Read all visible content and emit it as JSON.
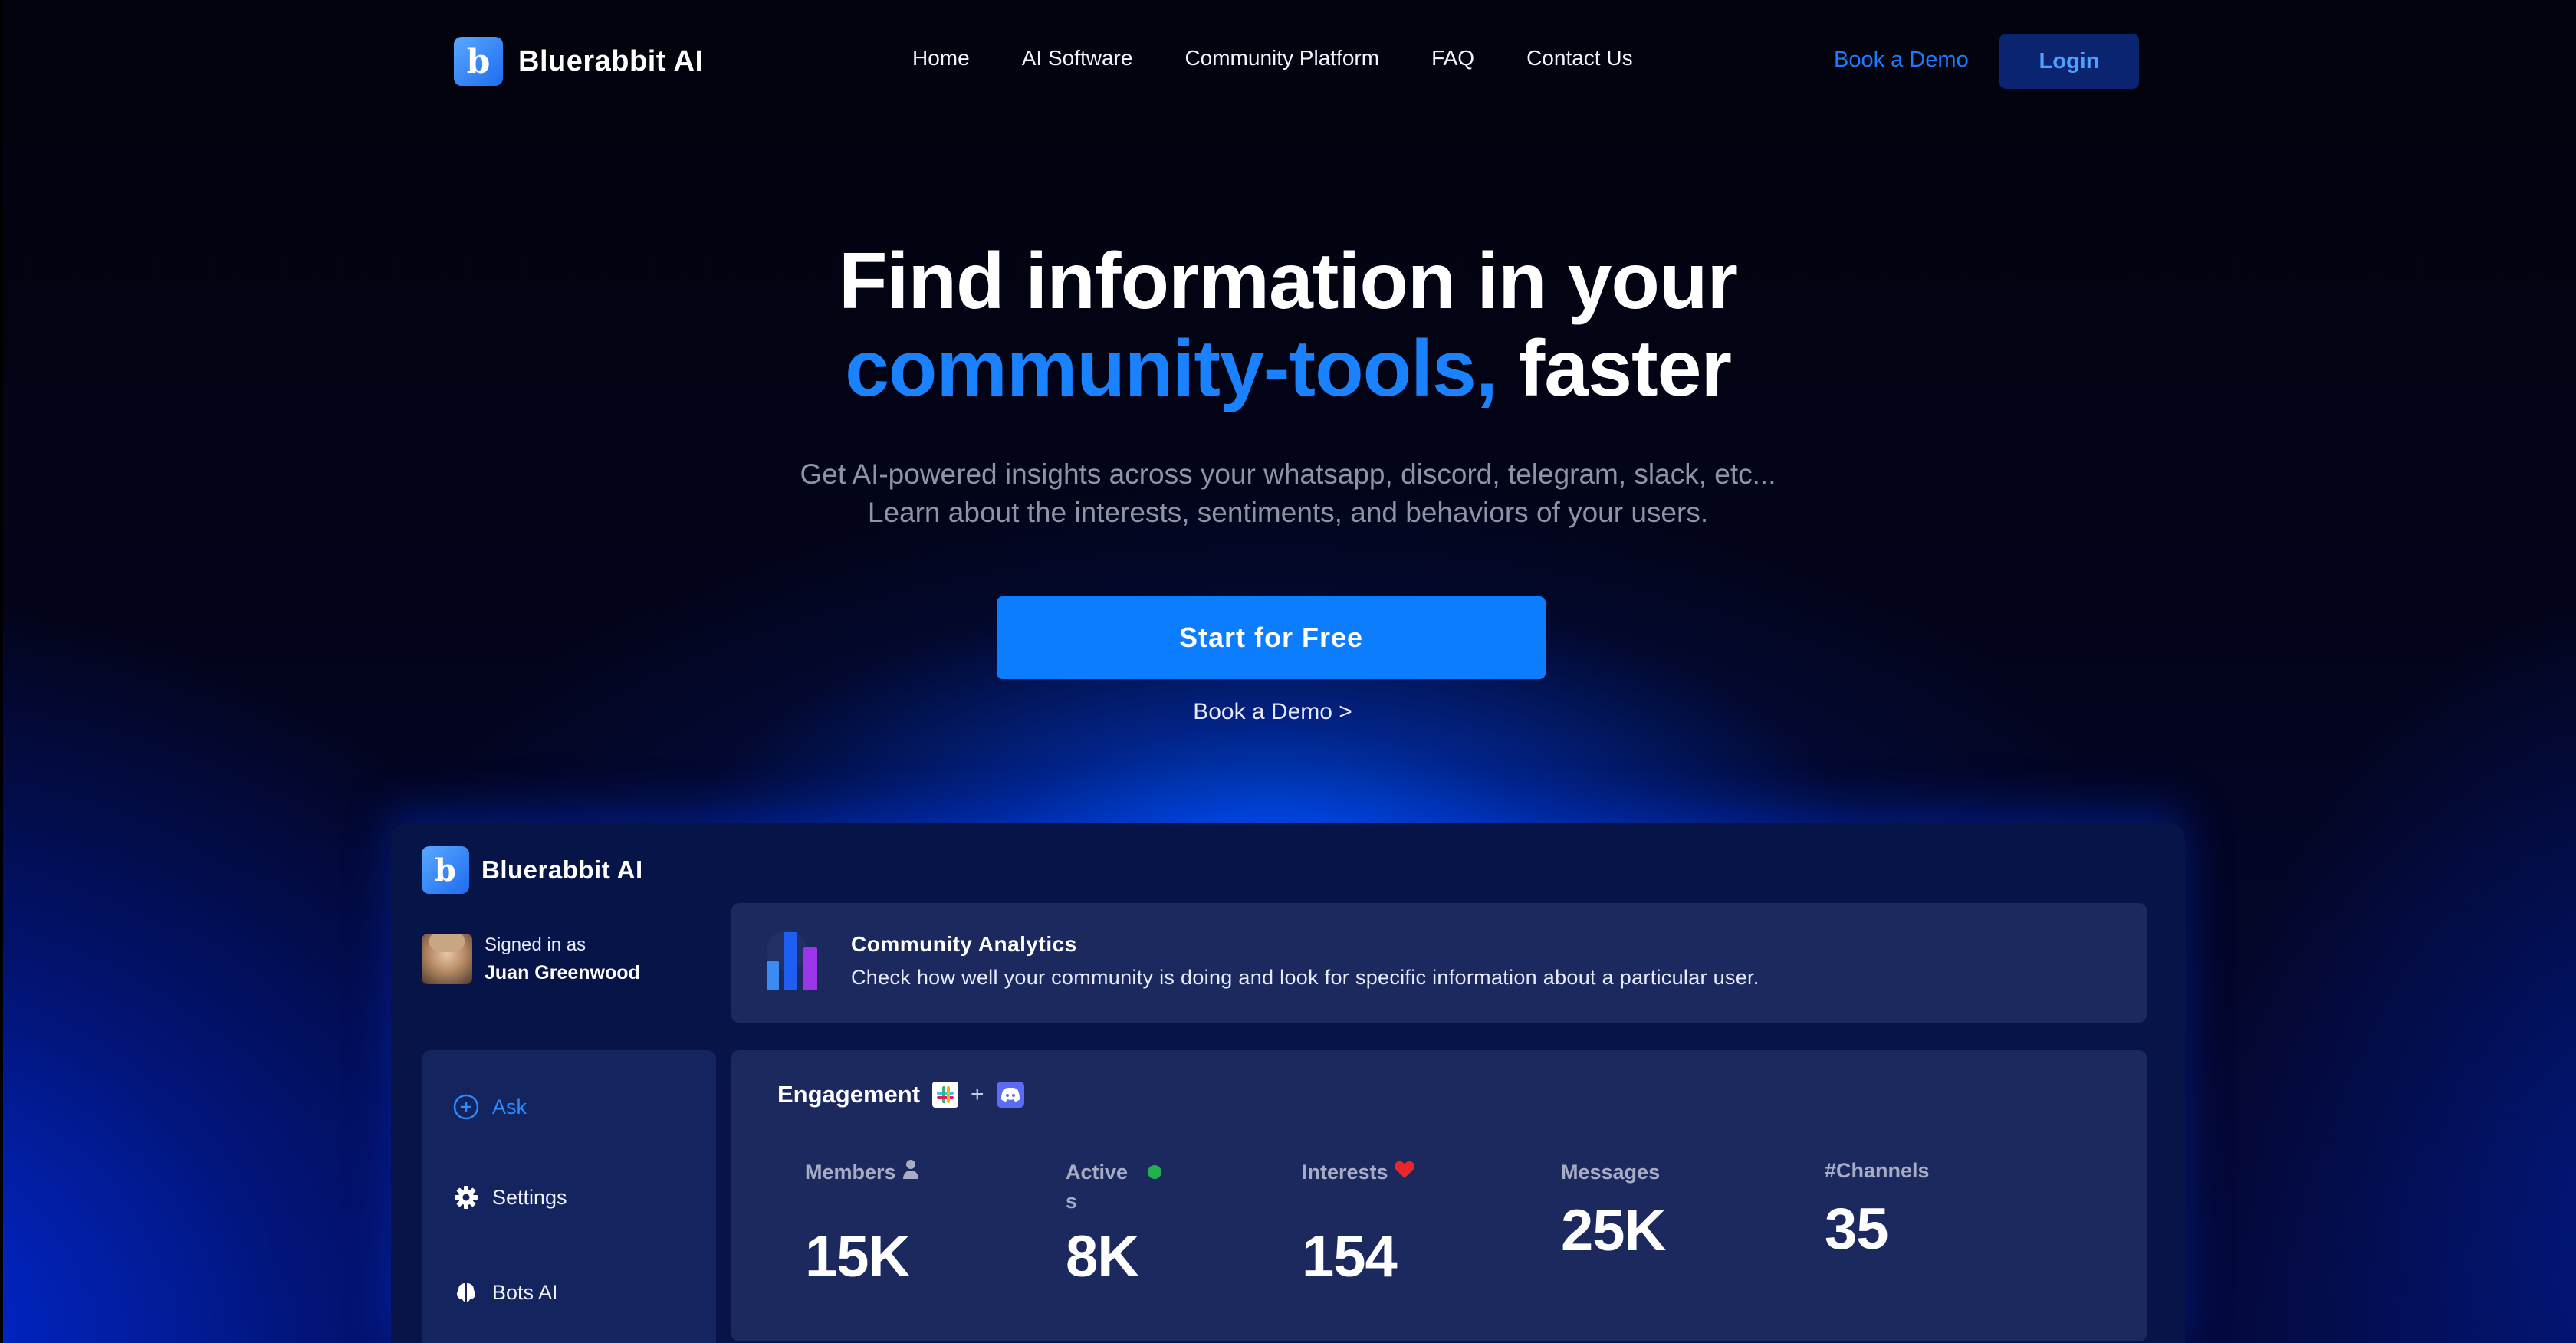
{
  "nav": {
    "brand": "Bluerabbit AI",
    "links": [
      "Home",
      "AI Software",
      "Community Platform",
      "FAQ",
      "Contact Us"
    ],
    "book_demo": "Book a Demo",
    "login": "Login"
  },
  "hero": {
    "title_line1": "Find information in your",
    "title_accent": "community-tools,",
    "title_tail": "faster",
    "subtitle_line1": "Get AI-powered insights across your whatsapp, discord, telegram, slack, etc...",
    "subtitle_line2": "Learn about the interests, sentiments, and behaviors of your users.",
    "cta": "Start for Free",
    "secondary": "Book a Demo >"
  },
  "dashboard": {
    "brand": "Bluerabbit AI",
    "signed_label": "Signed in as",
    "user_name": "Juan Greenwood",
    "sidebar": [
      {
        "label": "Ask",
        "icon": "plus-circle-icon"
      },
      {
        "label": "Settings",
        "icon": "gear-icon"
      },
      {
        "label": "Bots AI",
        "icon": "brain-icon"
      }
    ],
    "analytics": {
      "title": "Community Analytics",
      "description": "Check how well your community is doing and look for specific information about a particular user."
    },
    "engagement": {
      "title": "Engagement",
      "plus": "+",
      "stats": [
        {
          "label": "Members",
          "value": "15K",
          "icon": "user-icon"
        },
        {
          "label_a": "Active",
          "label_b": "s",
          "value": "8K",
          "icon": "green-dot-icon"
        },
        {
          "label": "Interests",
          "value": "154",
          "icon": "heart-icon"
        },
        {
          "label": "Messages",
          "value": "25K"
        },
        {
          "label": "#Channels",
          "value": "35"
        }
      ]
    }
  },
  "colors": {
    "accent": "#1b82ff",
    "cta": "#0d7dff",
    "login_bg": "#0b2470",
    "card": "#1b295f",
    "dashboard_bg": "#071447"
  }
}
